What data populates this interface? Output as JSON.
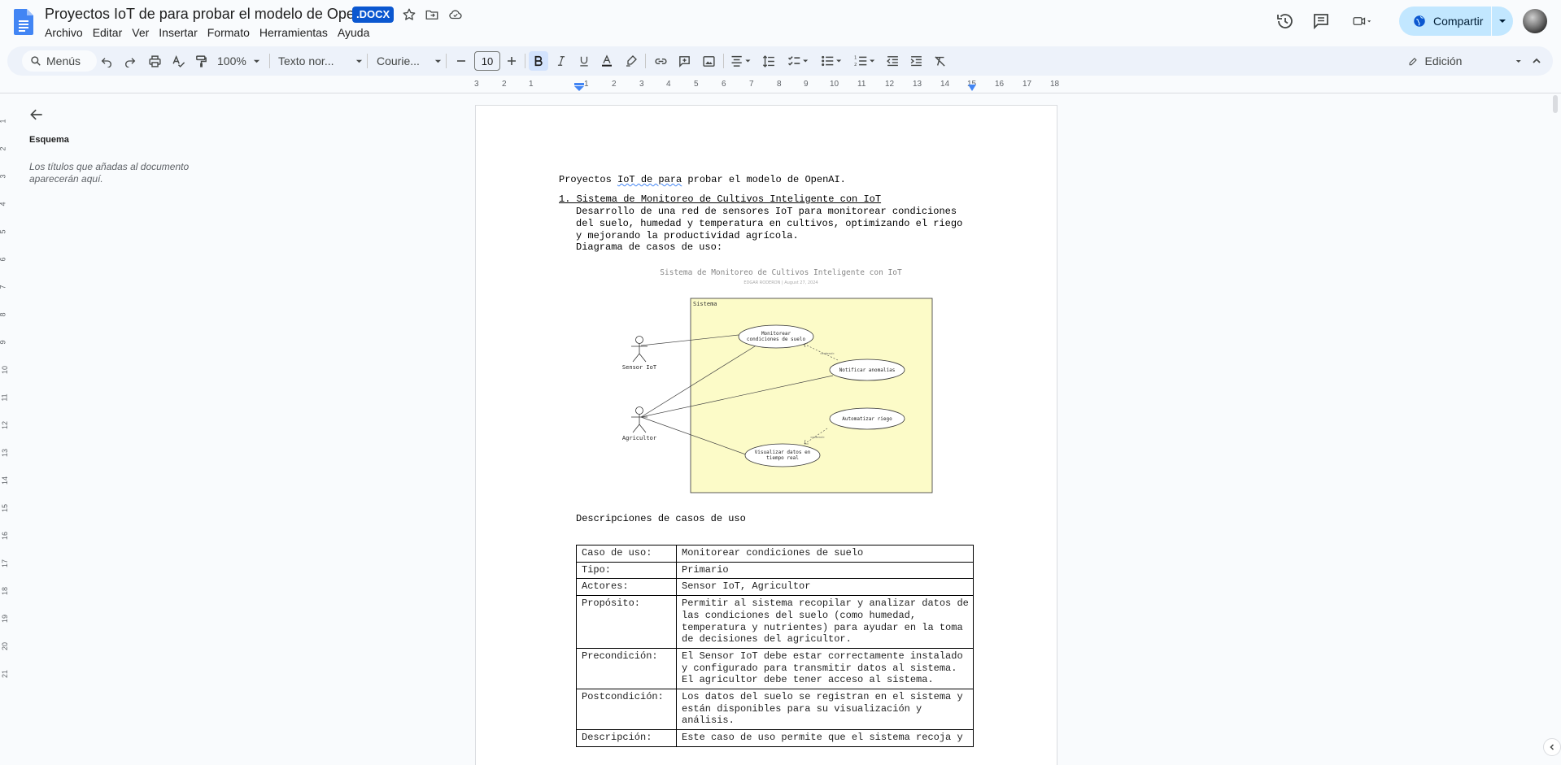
{
  "app": {
    "title": "Proyectos IoT de para probar el modelo de OpenAI",
    "badge": ".DOCX",
    "menu": [
      "Archivo",
      "Editar",
      "Ver",
      "Insertar",
      "Formato",
      "Herramientas",
      "Ayuda"
    ],
    "share_label": "Compartir",
    "accent_color": "#0b57d0",
    "share_bg": "#c2e7ff"
  },
  "toolbar": {
    "search_label": "Menús",
    "zoom": "100%",
    "style": "Texto nor...",
    "font": "Courie...",
    "font_size": "10",
    "mode": "Edición",
    "icons": [
      "undo-icon",
      "redo-icon",
      "print-icon",
      "spellcheck-icon",
      "paint-format-icon",
      "bold-icon",
      "italic-icon",
      "underline-icon",
      "text-color-icon",
      "highlight-icon",
      "link-icon",
      "comment-icon",
      "image-icon",
      "align-icon",
      "line-spacing-icon",
      "checklist-icon",
      "bullet-list-icon",
      "numbered-list-icon",
      "decrease-indent-icon",
      "increase-indent-icon",
      "clear-format-icon"
    ]
  },
  "ruler": {
    "h_ticks": [
      "3",
      "2",
      "1",
      "1",
      "2",
      "3",
      "4",
      "5",
      "6",
      "7",
      "8",
      "9",
      "10",
      "11",
      "12",
      "13",
      "14",
      "15",
      "16",
      "17",
      "18"
    ],
    "v_ticks": [
      "1",
      "2",
      "3",
      "4",
      "5",
      "6",
      "7",
      "8",
      "9",
      "10",
      "11",
      "12",
      "13",
      "14",
      "15",
      "16",
      "17",
      "18",
      "19",
      "20",
      "21"
    ]
  },
  "outline": {
    "title": "Esquema",
    "hint": "Los títulos que añadas al documento aparecerán aquí."
  },
  "document": {
    "heading_a": "Proyectos ",
    "heading_b": "IoT de para",
    "heading_c": " probar el modelo de OpenAI.",
    "item1": "1. Sistema de Monitoreo de Cultivos Inteligente con IoT",
    "para": [
      "Desarrollo de una red de sensores IoT para monitorear condiciones",
      "del suelo, humedad y temperatura en cultivos, optimizando el riego",
      "y mejorando la productividad agrícola."
    ],
    "diagram_label": "Diagrama de casos de uso:",
    "desc_label": "Descripciones de casos de uso"
  },
  "diagram": {
    "title": "Sistema de Monitoreo de Cultivos Inteligente con IoT",
    "subtitle": "EDGAR RODERON  |  August 27, 2024",
    "system_label": "Sistema",
    "actors": [
      "Sensor IoT",
      "Agricultor"
    ],
    "usecases": [
      [
        "Monitorear",
        "condiciones de suelo"
      ],
      [
        "Notificar anomalías"
      ],
      [
        "Automatizar riego"
      ],
      [
        "Visualizar datos en",
        "tiempo real"
      ]
    ],
    "extend_label": "«extend»",
    "fill_color": "#fcfbc8"
  },
  "table": [
    {
      "k": "Caso de uso:",
      "v": "Monitorear condiciones de suelo"
    },
    {
      "k": "Tipo:",
      "v": "Primario"
    },
    {
      "k": "Actores:",
      "v": "Sensor IoT, Agricultor"
    },
    {
      "k": "Propósito:",
      "v": "Permitir al sistema recopilar y analizar datos de las condiciones del suelo (como humedad, temperatura y nutrientes) para ayudar en la toma de decisiones del agricultor."
    },
    {
      "k": "Precondición:",
      "v": "El Sensor IoT debe estar correctamente instalado y configurado para transmitir datos al sistema. El agricultor debe tener acceso al sistema."
    },
    {
      "k": "Postcondición:",
      "v": "Los datos del suelo se registran en el sistema y están disponibles para su visualización y análisis."
    },
    {
      "k": "Descripción:",
      "v": "Este caso de uso permite que el sistema recoja y"
    }
  ]
}
